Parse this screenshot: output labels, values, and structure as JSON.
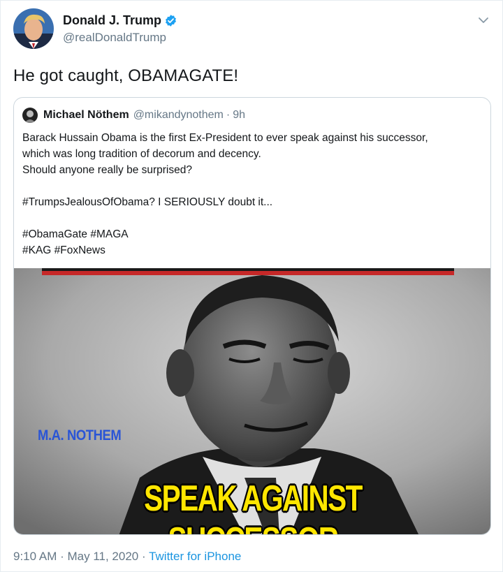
{
  "author": {
    "display_name": "Donald J. Trump",
    "handle": "@realDonaldTrump",
    "verified": true,
    "avatar_icon": "profile-photo"
  },
  "tweet": {
    "text": "He got caught, OBAMAGATE!",
    "time": "9:10 AM",
    "date": "May 11, 2020",
    "source": "Twitter for iPhone",
    "separator": "·"
  },
  "quoted": {
    "display_name": "Michael Nöthem",
    "handle": "@mikandynothem",
    "separator": "·",
    "time_ago": "9h",
    "lines": [
      "Barack Hussain Obama is the first Ex-President to ever speak against his successor,",
      "which was long tradition of decorum and decency.",
      "Should anyone really be surprised?",
      "",
      "#TrumpsJealousOfObama? I SERIOUSLY doubt it...",
      "",
      "#ObamaGate #MAGA",
      "#KAG #FoxNews"
    ],
    "image": {
      "watermark": "M.A. NOTHEM",
      "caption": "SPEAK AGAINST SUCCESSOR",
      "caption_color": "#ffe600",
      "watermark_color": "#2a55d6"
    }
  },
  "colors": {
    "verified_blue": "#1da1f2",
    "link_blue": "#1b95e0",
    "secondary_text": "#657786"
  }
}
